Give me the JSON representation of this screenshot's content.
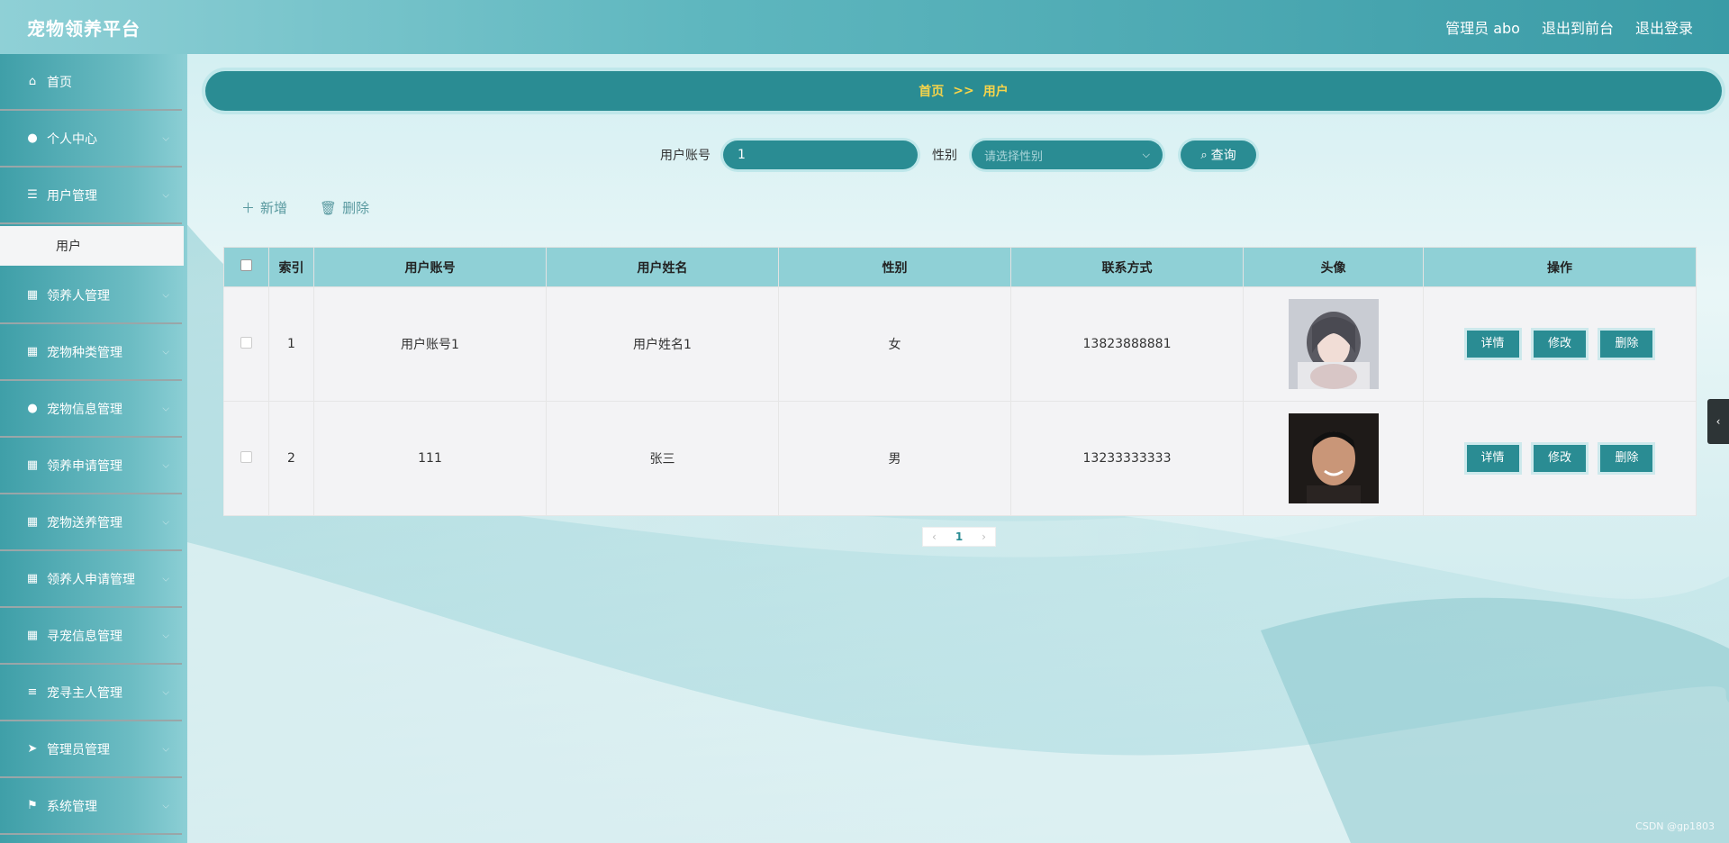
{
  "header": {
    "brand": "宠物领养平台",
    "admin_label": "管理员 abo",
    "to_front": "退出到前台",
    "logout": "退出登录"
  },
  "sidebar": {
    "items": [
      {
        "label": "首页",
        "icon": "home-icon"
      },
      {
        "label": "个人中心",
        "icon": "user-icon"
      },
      {
        "label": "用户管理",
        "icon": "sliders-icon"
      },
      {
        "label": "领养人管理",
        "icon": "grid-icon"
      },
      {
        "label": "宠物种类管理",
        "icon": "grid-icon"
      },
      {
        "label": "宠物信息管理",
        "icon": "user-icon"
      },
      {
        "label": "领养申请管理",
        "icon": "grid-icon"
      },
      {
        "label": "宠物送养管理",
        "icon": "grid-icon"
      },
      {
        "label": "领养人申请管理",
        "icon": "grid-icon"
      },
      {
        "label": "寻宠信息管理",
        "icon": "grid-icon"
      },
      {
        "label": "宠寻主人管理",
        "icon": "list-icon"
      },
      {
        "label": "管理员管理",
        "icon": "send-icon"
      },
      {
        "label": "系统管理",
        "icon": "flag-icon"
      }
    ],
    "active_submenu": "用户"
  },
  "breadcrumb": {
    "home": "首页",
    "sep": ">>",
    "current": "用户"
  },
  "search": {
    "account_label": "用户账号",
    "account_value": "1",
    "gender_label": "性别",
    "gender_placeholder": "请选择性别",
    "query_button": "查询"
  },
  "actions": {
    "add": "新增",
    "delete": "删除"
  },
  "table": {
    "headers": [
      "索引",
      "用户账号",
      "用户姓名",
      "性别",
      "联系方式",
      "头像",
      "操作"
    ],
    "rows": [
      {
        "index": "1",
        "account": "用户账号1",
        "name": "用户姓名1",
        "gender": "女",
        "phone": "13823888881"
      },
      {
        "index": "2",
        "account": "111",
        "name": "张三",
        "gender": "男",
        "phone": "13233333333"
      }
    ],
    "row_actions": {
      "detail": "详情",
      "edit": "修改",
      "delete": "删除"
    }
  },
  "pagination": {
    "current_page": "1"
  },
  "watermark": "CSDN @gp1803",
  "colors": {
    "accent": "#2a8c93",
    "header_bg": "#5fb7bf",
    "breadcrumb_text": "#f7d44a"
  }
}
